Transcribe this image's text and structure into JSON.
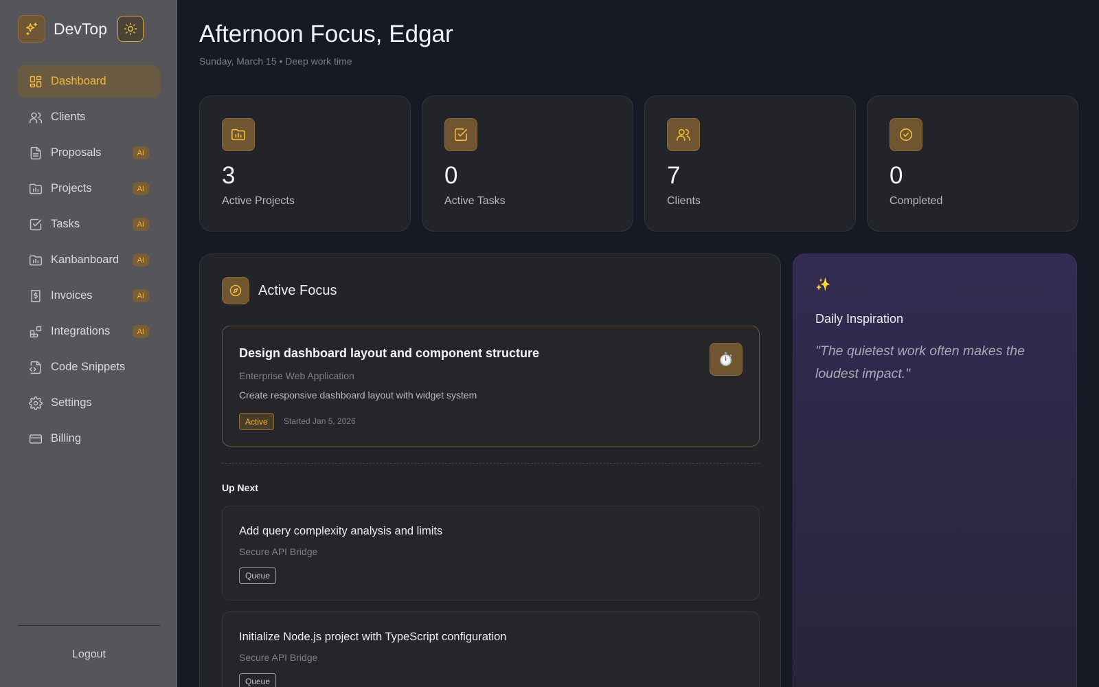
{
  "brand": {
    "name": "DevTop",
    "logo_icon": "sparkles-icon",
    "theme_icon": "sun-icon"
  },
  "nav": {
    "items": [
      {
        "label": "Dashboard",
        "icon": "dashboard-icon",
        "active": true,
        "badge": ""
      },
      {
        "label": "Clients",
        "icon": "users-icon",
        "badge": ""
      },
      {
        "label": "Proposals",
        "icon": "document-icon",
        "badge": "AI"
      },
      {
        "label": "Projects",
        "icon": "folder-chart-icon",
        "badge": "AI"
      },
      {
        "label": "Tasks",
        "icon": "checkbox-icon",
        "badge": "AI"
      },
      {
        "label": "Kanbanboard",
        "icon": "folder-chart-icon",
        "badge": "AI"
      },
      {
        "label": "Invoices",
        "icon": "receipt-icon",
        "badge": "AI"
      },
      {
        "label": "Integrations",
        "icon": "blocks-icon",
        "badge": "AI"
      },
      {
        "label": "Code Snippets",
        "icon": "code-file-icon",
        "badge": ""
      },
      {
        "label": "Settings",
        "icon": "gear-icon",
        "badge": ""
      },
      {
        "label": "Billing",
        "icon": "credit-card-icon",
        "badge": ""
      }
    ],
    "logout": "Logout"
  },
  "header": {
    "greeting": "Afternoon Focus, Edgar",
    "subline": "Sunday, March 15 • Deep work time"
  },
  "stats": [
    {
      "value": "3",
      "label": "Active Projects",
      "icon": "folder-chart-icon"
    },
    {
      "value": "0",
      "label": "Active Tasks",
      "icon": "checkbox-icon"
    },
    {
      "value": "7",
      "label": "Clients",
      "icon": "users-icon"
    },
    {
      "value": "0",
      "label": "Completed",
      "icon": "check-circle-icon"
    }
  ],
  "focus": {
    "title": "Active Focus",
    "icon": "compass-icon",
    "current": {
      "title": "Design dashboard layout and component structure",
      "project": "Enterprise Web Application",
      "description": "Create responsive dashboard layout with widget system",
      "status": "Active",
      "started": "Started Jan 5, 2026",
      "timer_icon": "⏱️"
    },
    "up_next_label": "Up Next",
    "queue": [
      {
        "title": "Add query complexity analysis and limits",
        "project": "Secure API Bridge",
        "status": "Queue"
      },
      {
        "title": "Initialize Node.js project with TypeScript configuration",
        "project": "Secure API Bridge",
        "status": "Queue"
      }
    ]
  },
  "inspiration": {
    "icon": "✨",
    "title": "Daily Inspiration",
    "quote": "\"The quietest work often makes the loudest impact.\""
  },
  "colors": {
    "accent": "#f2b93b",
    "sidebar": "#56565a",
    "background": "#161a24",
    "card": "#23242a"
  }
}
